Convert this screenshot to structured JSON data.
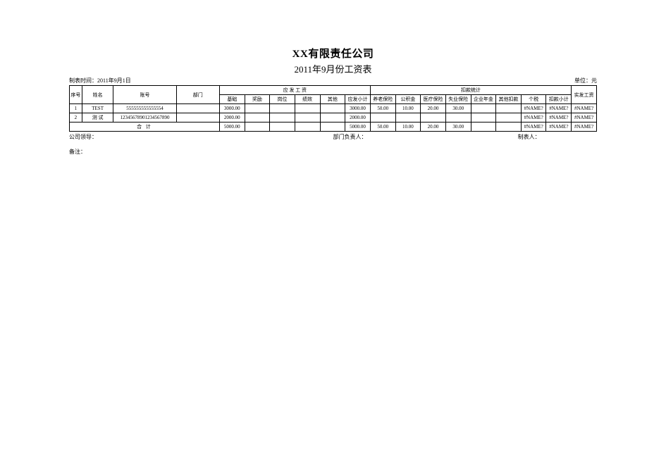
{
  "header": {
    "company": "XX有限责任公司",
    "report_title": "2011年9月份工资表",
    "made_label": "制表时间：",
    "made_date": "2011年9月1日",
    "unit_label": "单位：",
    "unit_value": "元"
  },
  "columns": {
    "seq": "序号",
    "name": "姓名",
    "account": "账号",
    "dept": "部门",
    "pay_group": "应 发 工 资",
    "deduct_group": "扣款统计",
    "net": "实发工资",
    "pay": {
      "base": "基础",
      "bonus": "奖励",
      "post": "岗位",
      "perf": "绩效",
      "other": "其他",
      "subtotal": "应发小计"
    },
    "deduct": {
      "pension": "养老保险",
      "fund": "公积金",
      "medical": "医疗保险",
      "unemp": "失业保险",
      "annuity": "企业年金",
      "other": "其他扣款",
      "tax": "个税",
      "subtotal": "扣款小计"
    }
  },
  "rows": [
    {
      "seq": "1",
      "name": "TEST",
      "account": "555555555555554",
      "dept": "",
      "base": "3000.00",
      "bonus": "",
      "post": "",
      "perf": "",
      "other_pay": "",
      "pay_sub": "3000.00",
      "pension": "50.00",
      "fund": "10.00",
      "medical": "20.00",
      "unemp": "30.00",
      "annuity": "",
      "other_ded": "",
      "tax": "#NAME?",
      "ded_sub": "#NAME?",
      "net": "#NAME?"
    },
    {
      "seq": "2",
      "name": "测   试",
      "account": "12345678901234567890",
      "dept": "",
      "base": "2000.00",
      "bonus": "",
      "post": "",
      "perf": "",
      "other_pay": "",
      "pay_sub": "2000.00",
      "pension": "",
      "fund": "",
      "medical": "",
      "unemp": "",
      "annuity": "",
      "other_ded": "",
      "tax": "#NAME?",
      "ded_sub": "#NAME?",
      "net": "#NAME?"
    }
  ],
  "total": {
    "label": "合   计",
    "base": "5000.00",
    "bonus": "",
    "post": "",
    "perf": "",
    "other_pay": "",
    "pay_sub": "5000.00",
    "pension": "50.00",
    "fund": "10.00",
    "medical": "20.00",
    "unemp": "30.00",
    "annuity": "",
    "other_ded": "",
    "tax": "#NAME?",
    "ded_sub": "#NAME?",
    "net": "#NAME?"
  },
  "footer": {
    "leader": "公司领导：",
    "dept_head": "部门负责人：",
    "preparer": "制表人：",
    "remark": "备注："
  }
}
